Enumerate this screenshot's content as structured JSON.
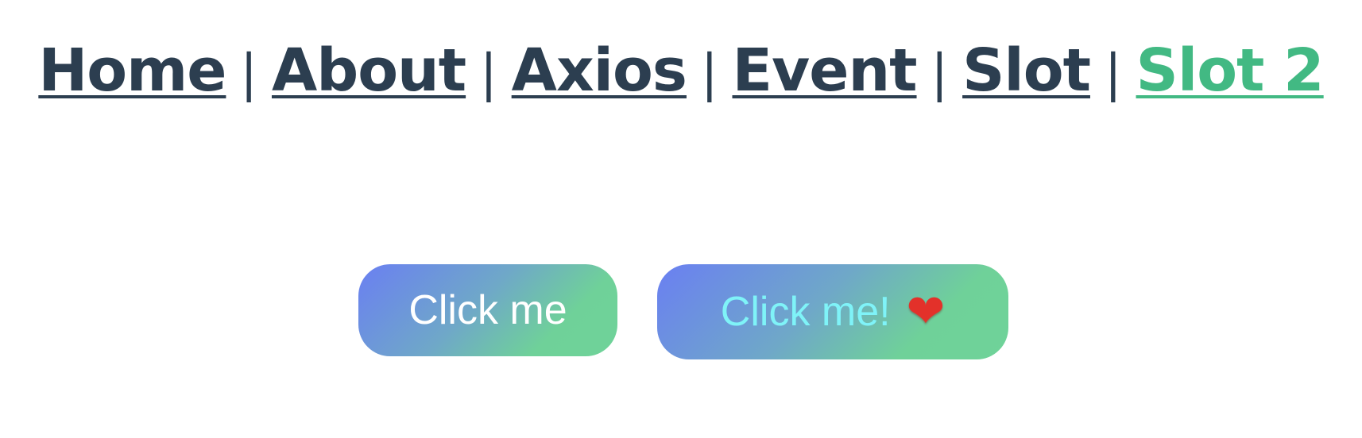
{
  "nav": {
    "links": [
      {
        "label": "Home",
        "active": false
      },
      {
        "label": "About",
        "active": false
      },
      {
        "label": "Axios",
        "active": false
      },
      {
        "label": "Event",
        "active": false
      },
      {
        "label": "Slot",
        "active": false
      },
      {
        "label": "Slot 2",
        "active": true
      }
    ],
    "separator": "|",
    "link_color": "#2c3e50",
    "active_color": "#42b983"
  },
  "buttons": {
    "first": {
      "label": "Click me"
    },
    "second": {
      "label": "Click me!",
      "icon": "heart-icon",
      "icon_glyph": "❤"
    }
  },
  "colors": {
    "gradient_start": "#6a7ff2",
    "gradient_end": "#6fd399",
    "second_text": "#7ff3f8"
  }
}
